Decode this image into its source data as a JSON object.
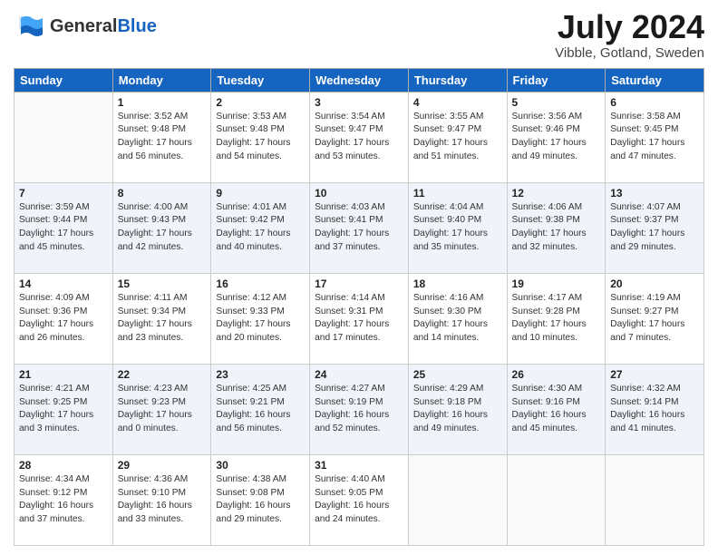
{
  "header": {
    "logo_general": "General",
    "logo_blue": "Blue",
    "month": "July 2024",
    "location": "Vibble, Gotland, Sweden"
  },
  "days_of_week": [
    "Sunday",
    "Monday",
    "Tuesday",
    "Wednesday",
    "Thursday",
    "Friday",
    "Saturday"
  ],
  "weeks": [
    {
      "stripe": false,
      "days": [
        {
          "num": "",
          "info": ""
        },
        {
          "num": "1",
          "info": "Sunrise: 3:52 AM\nSunset: 9:48 PM\nDaylight: 17 hours\nand 56 minutes."
        },
        {
          "num": "2",
          "info": "Sunrise: 3:53 AM\nSunset: 9:48 PM\nDaylight: 17 hours\nand 54 minutes."
        },
        {
          "num": "3",
          "info": "Sunrise: 3:54 AM\nSunset: 9:47 PM\nDaylight: 17 hours\nand 53 minutes."
        },
        {
          "num": "4",
          "info": "Sunrise: 3:55 AM\nSunset: 9:47 PM\nDaylight: 17 hours\nand 51 minutes."
        },
        {
          "num": "5",
          "info": "Sunrise: 3:56 AM\nSunset: 9:46 PM\nDaylight: 17 hours\nand 49 minutes."
        },
        {
          "num": "6",
          "info": "Sunrise: 3:58 AM\nSunset: 9:45 PM\nDaylight: 17 hours\nand 47 minutes."
        }
      ]
    },
    {
      "stripe": true,
      "days": [
        {
          "num": "7",
          "info": "Sunrise: 3:59 AM\nSunset: 9:44 PM\nDaylight: 17 hours\nand 45 minutes."
        },
        {
          "num": "8",
          "info": "Sunrise: 4:00 AM\nSunset: 9:43 PM\nDaylight: 17 hours\nand 42 minutes."
        },
        {
          "num": "9",
          "info": "Sunrise: 4:01 AM\nSunset: 9:42 PM\nDaylight: 17 hours\nand 40 minutes."
        },
        {
          "num": "10",
          "info": "Sunrise: 4:03 AM\nSunset: 9:41 PM\nDaylight: 17 hours\nand 37 minutes."
        },
        {
          "num": "11",
          "info": "Sunrise: 4:04 AM\nSunset: 9:40 PM\nDaylight: 17 hours\nand 35 minutes."
        },
        {
          "num": "12",
          "info": "Sunrise: 4:06 AM\nSunset: 9:38 PM\nDaylight: 17 hours\nand 32 minutes."
        },
        {
          "num": "13",
          "info": "Sunrise: 4:07 AM\nSunset: 9:37 PM\nDaylight: 17 hours\nand 29 minutes."
        }
      ]
    },
    {
      "stripe": false,
      "days": [
        {
          "num": "14",
          "info": "Sunrise: 4:09 AM\nSunset: 9:36 PM\nDaylight: 17 hours\nand 26 minutes."
        },
        {
          "num": "15",
          "info": "Sunrise: 4:11 AM\nSunset: 9:34 PM\nDaylight: 17 hours\nand 23 minutes."
        },
        {
          "num": "16",
          "info": "Sunrise: 4:12 AM\nSunset: 9:33 PM\nDaylight: 17 hours\nand 20 minutes."
        },
        {
          "num": "17",
          "info": "Sunrise: 4:14 AM\nSunset: 9:31 PM\nDaylight: 17 hours\nand 17 minutes."
        },
        {
          "num": "18",
          "info": "Sunrise: 4:16 AM\nSunset: 9:30 PM\nDaylight: 17 hours\nand 14 minutes."
        },
        {
          "num": "19",
          "info": "Sunrise: 4:17 AM\nSunset: 9:28 PM\nDaylight: 17 hours\nand 10 minutes."
        },
        {
          "num": "20",
          "info": "Sunrise: 4:19 AM\nSunset: 9:27 PM\nDaylight: 17 hours\nand 7 minutes."
        }
      ]
    },
    {
      "stripe": true,
      "days": [
        {
          "num": "21",
          "info": "Sunrise: 4:21 AM\nSunset: 9:25 PM\nDaylight: 17 hours\nand 3 minutes."
        },
        {
          "num": "22",
          "info": "Sunrise: 4:23 AM\nSunset: 9:23 PM\nDaylight: 17 hours\nand 0 minutes."
        },
        {
          "num": "23",
          "info": "Sunrise: 4:25 AM\nSunset: 9:21 PM\nDaylight: 16 hours\nand 56 minutes."
        },
        {
          "num": "24",
          "info": "Sunrise: 4:27 AM\nSunset: 9:19 PM\nDaylight: 16 hours\nand 52 minutes."
        },
        {
          "num": "25",
          "info": "Sunrise: 4:29 AM\nSunset: 9:18 PM\nDaylight: 16 hours\nand 49 minutes."
        },
        {
          "num": "26",
          "info": "Sunrise: 4:30 AM\nSunset: 9:16 PM\nDaylight: 16 hours\nand 45 minutes."
        },
        {
          "num": "27",
          "info": "Sunrise: 4:32 AM\nSunset: 9:14 PM\nDaylight: 16 hours\nand 41 minutes."
        }
      ]
    },
    {
      "stripe": false,
      "days": [
        {
          "num": "28",
          "info": "Sunrise: 4:34 AM\nSunset: 9:12 PM\nDaylight: 16 hours\nand 37 minutes."
        },
        {
          "num": "29",
          "info": "Sunrise: 4:36 AM\nSunset: 9:10 PM\nDaylight: 16 hours\nand 33 minutes."
        },
        {
          "num": "30",
          "info": "Sunrise: 4:38 AM\nSunset: 9:08 PM\nDaylight: 16 hours\nand 29 minutes."
        },
        {
          "num": "31",
          "info": "Sunrise: 4:40 AM\nSunset: 9:05 PM\nDaylight: 16 hours\nand 24 minutes."
        },
        {
          "num": "",
          "info": ""
        },
        {
          "num": "",
          "info": ""
        },
        {
          "num": "",
          "info": ""
        }
      ]
    }
  ]
}
